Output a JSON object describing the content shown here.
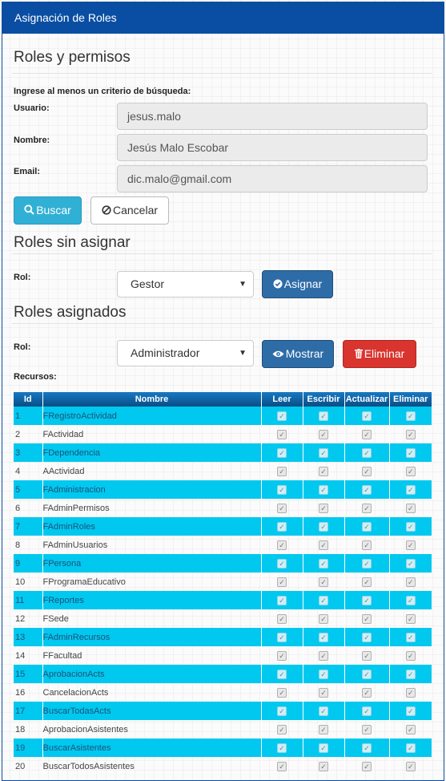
{
  "header": {
    "title": "Asignación de Roles"
  },
  "section_search": {
    "title": "Roles y permisos",
    "instruction": "Ingrese al menos un criterio de búsqueda:",
    "fields": [
      {
        "label": "Usuario:",
        "value": "jesus.malo"
      },
      {
        "label": "Nombre:",
        "value": "Jesús Malo Escobar"
      },
      {
        "label": "Email:",
        "value": "dic.malo@gmail.com"
      }
    ],
    "buttons": {
      "search": "Buscar",
      "cancel": "Cancelar"
    }
  },
  "section_unassigned": {
    "title": "Roles sin asignar",
    "role_label": "Rol:",
    "selected_role": "Gestor",
    "assign_button": "Asignar"
  },
  "section_assigned": {
    "title": "Roles asignados",
    "role_label": "Rol:",
    "selected_role": "Administrador",
    "show_button": "Mostrar",
    "delete_button": "Eliminar",
    "resources_label": "Recursos:"
  },
  "table": {
    "columns": [
      "Id",
      "Nombre",
      "Leer",
      "Escribir",
      "Actualizar",
      "Eliminar"
    ],
    "rows": [
      {
        "id": "1",
        "name": "FRegistroActividad",
        "perms": [
          true,
          true,
          true,
          true
        ]
      },
      {
        "id": "2",
        "name": "FActividad",
        "perms": [
          true,
          true,
          true,
          true
        ]
      },
      {
        "id": "3",
        "name": "FDependencia",
        "perms": [
          true,
          true,
          true,
          false
        ]
      },
      {
        "id": "4",
        "name": "AActividad",
        "perms": [
          true,
          true,
          true,
          true
        ]
      },
      {
        "id": "5",
        "name": "FAdministracion",
        "perms": [
          true,
          true,
          true,
          true
        ]
      },
      {
        "id": "6",
        "name": "FAdminPermisos",
        "perms": [
          true,
          true,
          true,
          true
        ]
      },
      {
        "id": "7",
        "name": "FAdminRoles",
        "perms": [
          true,
          true,
          false,
          true
        ]
      },
      {
        "id": "8",
        "name": "FAdminUsuarios",
        "perms": [
          true,
          true,
          true,
          true
        ]
      },
      {
        "id": "9",
        "name": "FPersona",
        "perms": [
          true,
          true,
          true,
          true
        ]
      },
      {
        "id": "10",
        "name": "FProgramaEducativo",
        "perms": [
          true,
          true,
          true,
          true
        ]
      },
      {
        "id": "11",
        "name": "FReportes",
        "perms": [
          true,
          true,
          true,
          true
        ]
      },
      {
        "id": "12",
        "name": "FSede",
        "perms": [
          true,
          true,
          true,
          true
        ]
      },
      {
        "id": "13",
        "name": "FAdminRecursos",
        "perms": [
          true,
          false,
          true,
          true
        ]
      },
      {
        "id": "14",
        "name": "FFacultad",
        "perms": [
          true,
          true,
          true,
          true
        ]
      },
      {
        "id": "15",
        "name": "AprobacionActs",
        "perms": [
          true,
          true,
          true,
          true
        ]
      },
      {
        "id": "16",
        "name": "CancelacionActs",
        "perms": [
          true,
          true,
          true,
          true
        ]
      },
      {
        "id": "17",
        "name": "BuscarTodasActs",
        "perms": [
          true,
          true,
          true,
          true
        ]
      },
      {
        "id": "18",
        "name": "AprobacionAsistentes",
        "perms": [
          true,
          true,
          true,
          true
        ]
      },
      {
        "id": "19",
        "name": "BuscarAsistentes",
        "perms": [
          true,
          true,
          true,
          true
        ]
      },
      {
        "id": "20",
        "name": "BuscarTodosAsistentes",
        "perms": [
          true,
          true,
          true,
          true
        ]
      }
    ]
  },
  "colors": {
    "header_bg": "#0a4ea3",
    "row_highlight": "#00c8ef",
    "btn_info": "#31b0d5",
    "btn_primary": "#2e6ca8",
    "btn_danger": "#d9342e"
  }
}
